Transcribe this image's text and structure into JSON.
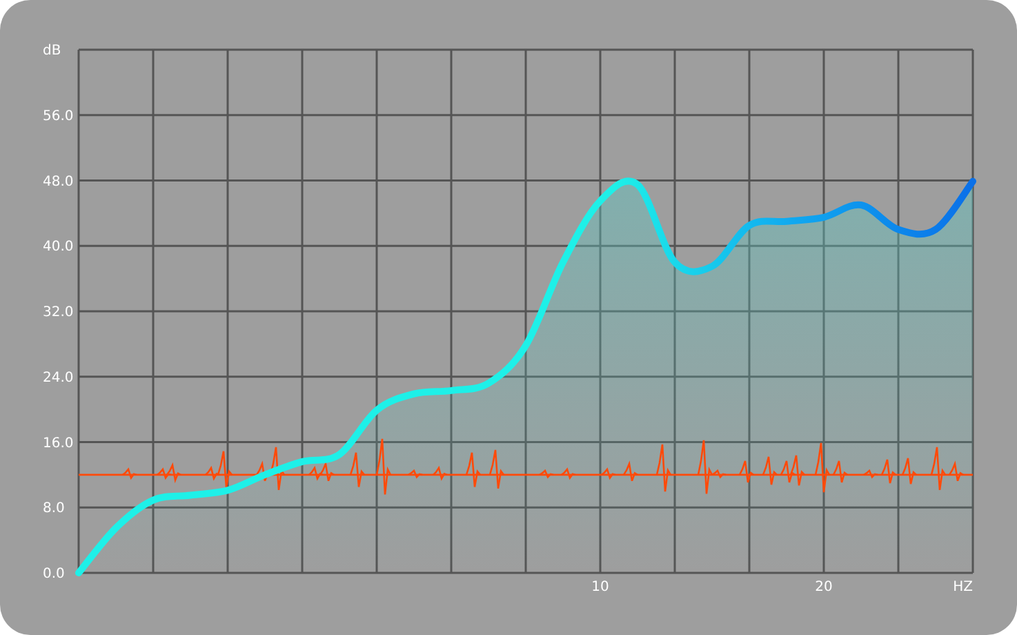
{
  "chart": {
    "chart_data": {
      "type": "area",
      "ylabel": "dB",
      "xlabel": "HZ",
      "categories": [
        null,
        null,
        null,
        null,
        null,
        null,
        null,
        null,
        null,
        null,
        null,
        null,
        null,
        null,
        "10",
        null,
        null,
        null,
        null,
        null,
        "20",
        null,
        null,
        null,
        null
      ],
      "series": [
        {
          "color": "#1ef0e8",
          "values": [
            0,
            5.5,
            8.9,
            9.5,
            10.1,
            12,
            13.6,
            14.5,
            19.9,
            21.9,
            22.3,
            23.2,
            27.8,
            38,
            45.5,
            47.5,
            38,
            37.5,
            42.5,
            43,
            43.5,
            45,
            42,
            42,
            47.9
          ]
        }
      ],
      "ylim": [
        0,
        64
      ],
      "grid": true,
      "ref_lines": [
        {
          "axis": "y",
          "value": 12,
          "color": "#ff4a0a"
        }
      ],
      "yticks": [
        {
          "value": 0,
          "label": "0.0"
        },
        {
          "value": 8,
          "label": "8.0"
        },
        {
          "value": 16,
          "label": "16.0"
        },
        {
          "value": 24,
          "label": "24.0"
        },
        {
          "value": 32,
          "label": "32.0"
        },
        {
          "value": 40,
          "label": "40.0"
        },
        {
          "value": 48,
          "label": "48.0"
        },
        {
          "value": 56,
          "label": "56.0"
        }
      ]
    }
  }
}
